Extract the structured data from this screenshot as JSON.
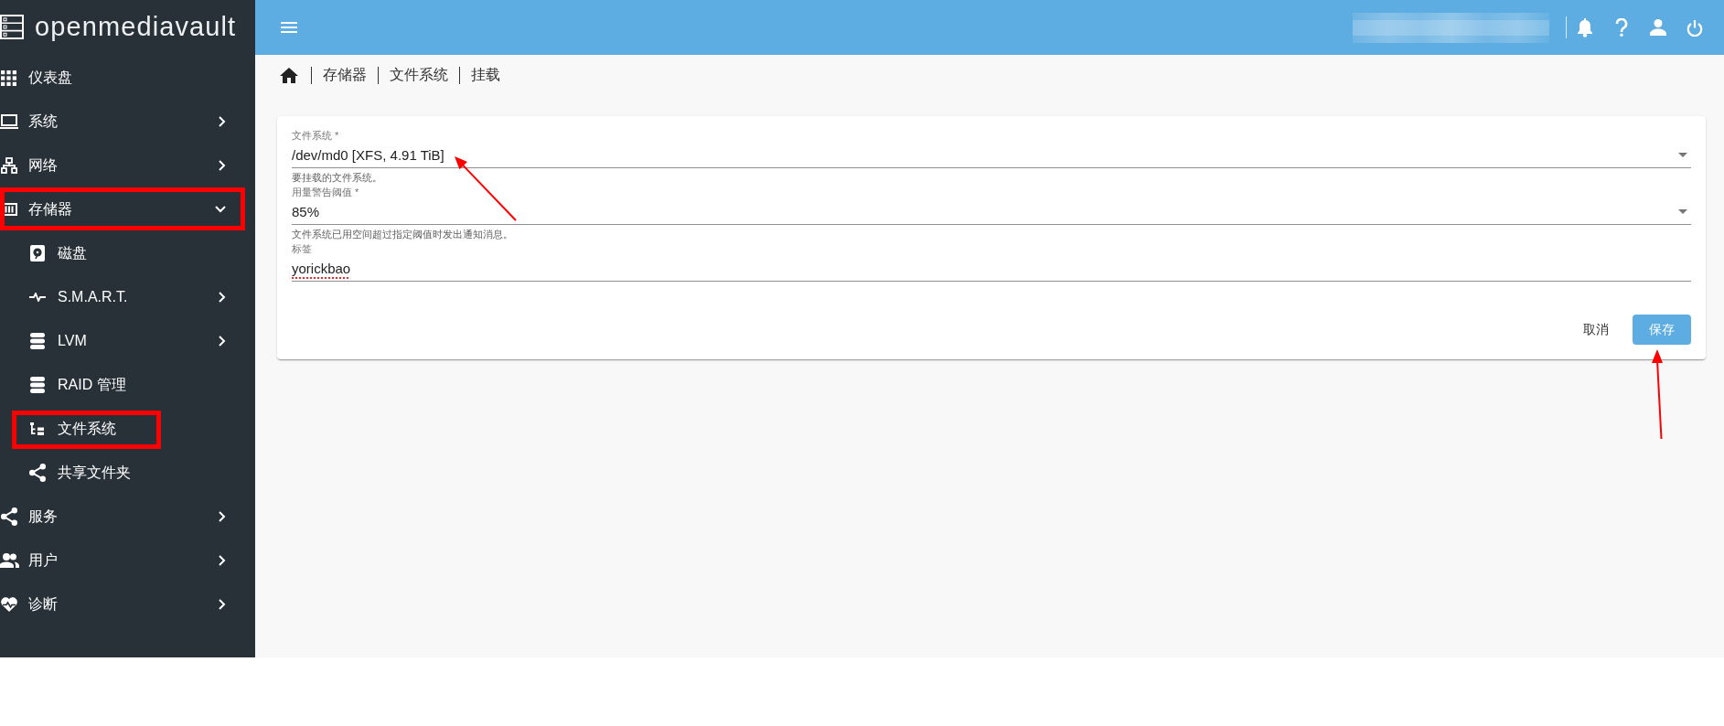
{
  "sidebar": {
    "logo": "openmediavault",
    "items": [
      {
        "label": "仪表盘",
        "annotated": false
      },
      {
        "label": "系统",
        "expanded": false,
        "annotated": false
      },
      {
        "label": "网络",
        "expanded": false,
        "annotated": false
      },
      {
        "label": "存储器",
        "expanded": true,
        "annotated": true,
        "children": [
          {
            "label": "磁盘",
            "annotated": false
          },
          {
            "label": "S.M.A.R.T.",
            "expanded": false,
            "annotated": false
          },
          {
            "label": "LVM",
            "expanded": false,
            "annotated": false
          },
          {
            "label": "RAID 管理",
            "annotated": false
          },
          {
            "label": "文件系统",
            "annotated": true
          },
          {
            "label": "共享文件夹",
            "annotated": false
          }
        ]
      },
      {
        "label": "服务",
        "expanded": false,
        "annotated": false
      },
      {
        "label": "用户",
        "expanded": false,
        "annotated": false
      },
      {
        "label": "诊断",
        "expanded": false,
        "annotated": false
      }
    ]
  },
  "breadcrumb": [
    "存储器",
    "文件系统",
    "挂载"
  ],
  "form": {
    "fields": [
      {
        "kind": "select",
        "label": "文件系统 *",
        "value": "/dev/md0 [XFS, 4.91 TiB]",
        "hint": "要挂载的文件系统。",
        "misspelled": false,
        "pointed_at": true
      },
      {
        "kind": "select",
        "label": "用量警告阈值 *",
        "value": "85%",
        "hint": "文件系统已用空间超过指定阈值时发出通知消息。",
        "misspelled": false,
        "pointed_at": false
      },
      {
        "kind": "text",
        "label": "标签",
        "value": "yorickbao",
        "misspelled": true,
        "pointed_at": false
      }
    ],
    "buttons": [
      {
        "kind": "flat",
        "label": "取消",
        "pointed_at": false
      },
      {
        "kind": "raised",
        "label": "保存",
        "pointed_at": true
      }
    ]
  }
}
